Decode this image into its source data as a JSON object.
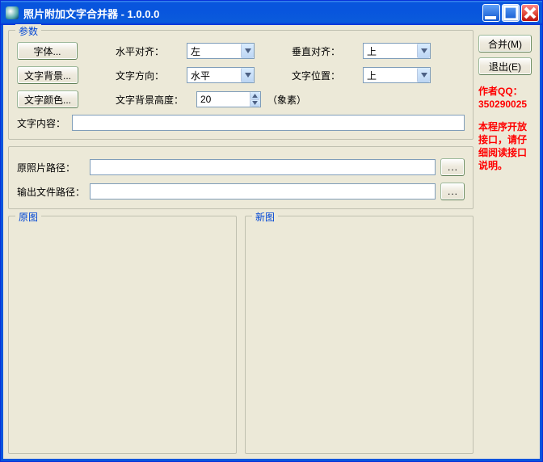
{
  "window": {
    "title": "照片附加文字合并器 - 1.0.0.0"
  },
  "params": {
    "legend": "参数",
    "font_btn": "字体...",
    "bg_btn": "文字背景...",
    "color_btn": "文字颜色...",
    "halign_lbl": "水平对齐：",
    "halign_val": "左",
    "valign_lbl": "垂直对齐：",
    "valign_val": "上",
    "dir_lbl": "文字方向：",
    "dir_val": "水平",
    "pos_lbl": "文字位置：",
    "pos_val": "上",
    "bgh_lbl": "文字背景高度：",
    "bgh_val": "20",
    "bgh_unit": "（象素）",
    "text_lbl": "文字内容：",
    "text_val": ""
  },
  "paths": {
    "src_lbl": "原照片路径：",
    "src_val": "",
    "out_lbl": "输出文件路径：",
    "out_val": "",
    "browse": "..."
  },
  "preview": {
    "src_legend": "原图",
    "out_legend": "新图"
  },
  "side": {
    "merge": "合并(M)",
    "exit": "退出(E)",
    "author_lbl": "作者QQ：",
    "author_qq": "350290025",
    "note": "本程序开放接口，请仔细阅读接口说明。"
  }
}
